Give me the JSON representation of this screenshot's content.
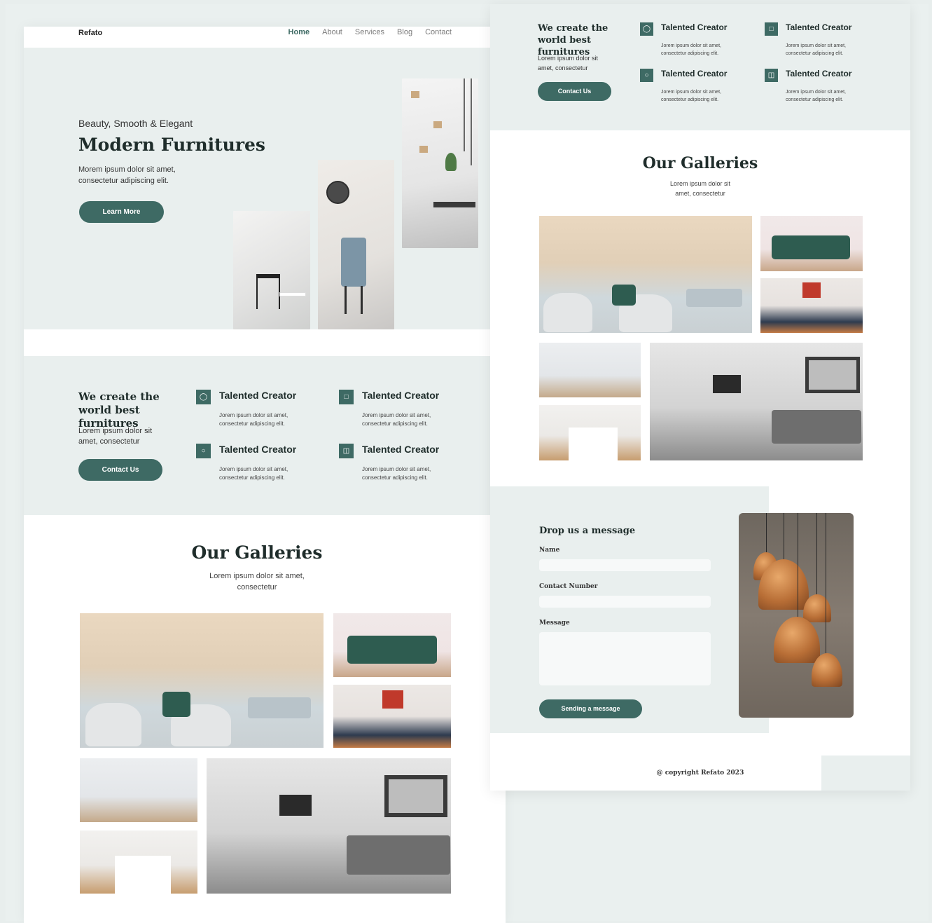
{
  "nav": {
    "brand": "Refato",
    "items": [
      "Home",
      "About",
      "Services",
      "Blog",
      "Contact"
    ]
  },
  "hero": {
    "subtitle": "Beauty, Smooth & Elegant",
    "title": "Modern Furnitures",
    "text": "Morem ipsum dolor sit amet, consectetur adipiscing elit.",
    "button": "Learn More"
  },
  "about": {
    "title": "We create  the world best furnitures",
    "text": "Lorem ipsum dolor sit amet, consectetur",
    "button": "Contact Us",
    "features": [
      {
        "title": "Talented Creator",
        "text": "Jorem ipsum dolor sit amet, consectetur adipiscing elit."
      },
      {
        "title": "Talented Creator",
        "text": "Jorem ipsum dolor sit amet, consectetur adipiscing elit."
      },
      {
        "title": "Talented Creator",
        "text": "Jorem ipsum dolor sit amet, consectetur adipiscing elit."
      },
      {
        "title": "Talented Creator",
        "text": "Jorem ipsum dolor sit amet, consectetur adipiscing elit."
      }
    ]
  },
  "gallery": {
    "title": "Our Galleries",
    "text": "Lorem ipsum dolor sit amet, consectetur"
  },
  "contact": {
    "title": "Drop us a message",
    "name_label": "Name",
    "phone_label": "Contact Number",
    "message_label": "Message",
    "button": "Sending a message"
  },
  "footer": {
    "copyright": "@ copyright Refato 2023"
  },
  "colors": {
    "accent": "#3e6a64",
    "band": "#e9efee"
  }
}
